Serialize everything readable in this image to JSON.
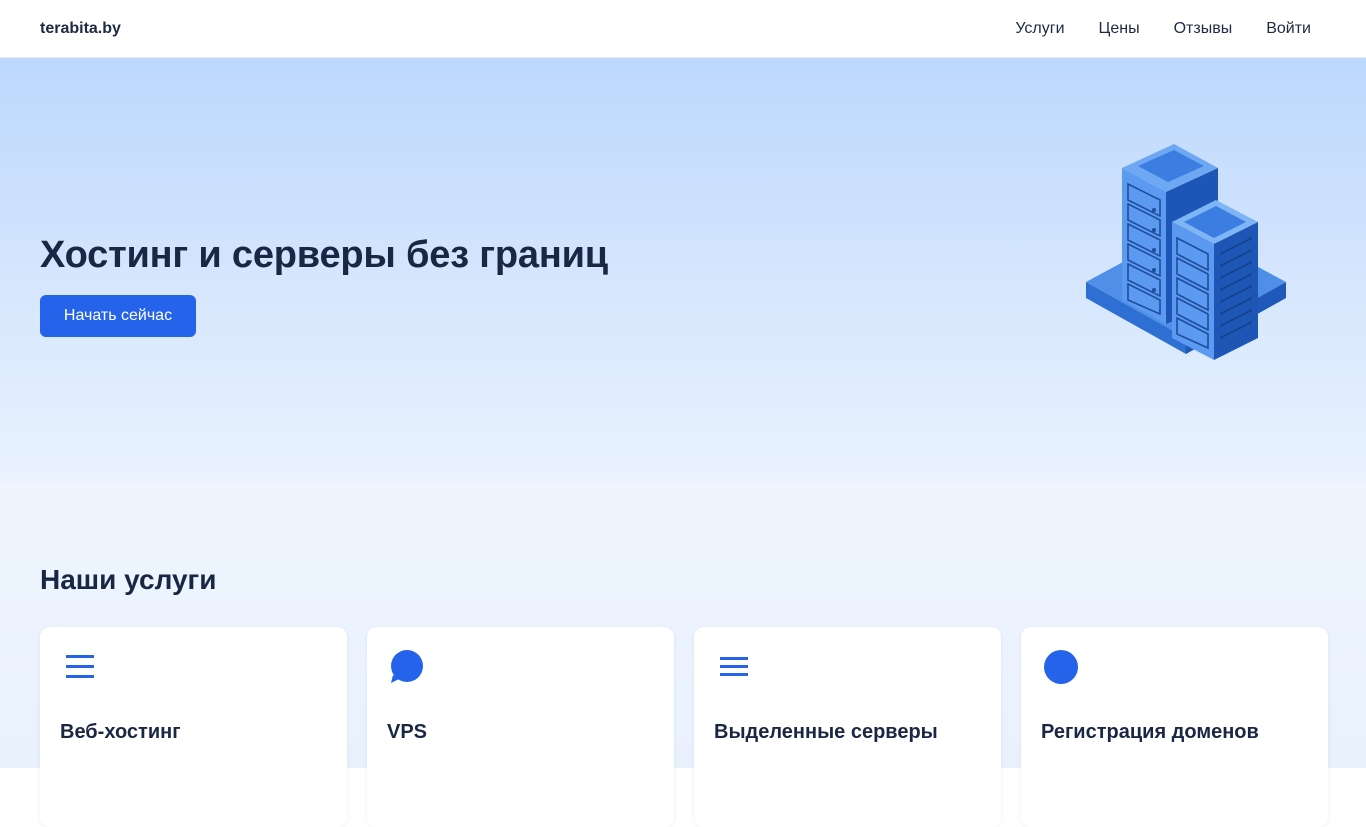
{
  "header": {
    "logo": "terabita.by",
    "nav": [
      {
        "label": "Услуги"
      },
      {
        "label": "Цены"
      },
      {
        "label": "Отзывы"
      },
      {
        "label": "Войти"
      }
    ]
  },
  "hero": {
    "title": "Хостинг и серверы без границ",
    "cta_label": "Начать сейчас",
    "illustration_icon": "server-racks-icon"
  },
  "services": {
    "title": "Наши услуги",
    "cards": [
      {
        "title": "Веб-хостинг",
        "icon": "menu-lines-icon"
      },
      {
        "title": "VPS",
        "icon": "chat-bubble-icon"
      },
      {
        "title": "Выделенные серверы",
        "icon": "menu-lines-icon"
      },
      {
        "title": "Регистрация доменов",
        "icon": "circle-icon"
      }
    ]
  },
  "colors": {
    "accent": "#2563eb",
    "text_dark": "#1a2744",
    "hero_top": "#bcd8fd",
    "hero_bottom": "#eaf3fe"
  }
}
